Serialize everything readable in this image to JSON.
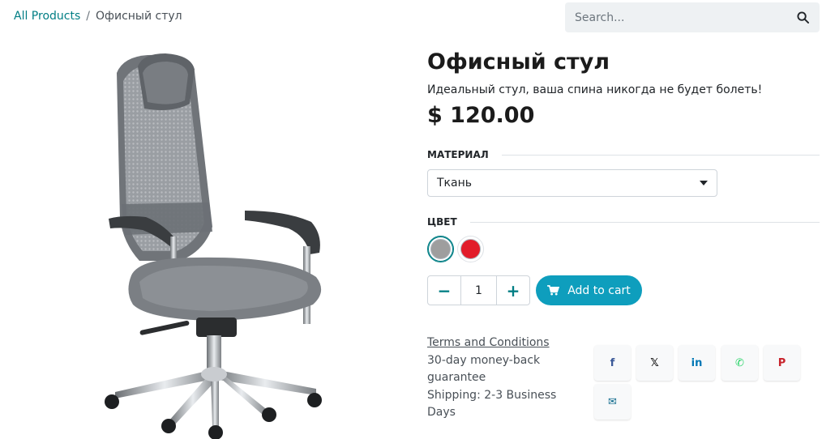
{
  "breadcrumb": {
    "root": "All Products",
    "separator": "/",
    "current": "Офисный стул"
  },
  "search": {
    "placeholder": "Search...",
    "icon": "search-icon"
  },
  "product": {
    "name": "Офисный стул",
    "description": "Идеальный стул, ваша спина никогда не будет болеть!",
    "price": "$ 120.00",
    "image": "office-chair-image"
  },
  "attributes": {
    "material": {
      "label": "МАТЕРИАЛ",
      "selected": "Ткань"
    },
    "color": {
      "label": "ЦВЕТ",
      "options": [
        {
          "name": "grey",
          "hex": "#9e9e9e",
          "selected": true
        },
        {
          "name": "red",
          "hex": "#e21c2a",
          "selected": false
        }
      ]
    }
  },
  "cart": {
    "quantity": "1",
    "minus": "−",
    "plus": "+",
    "add_label": "Add to cart"
  },
  "info": {
    "terms": "Terms and Conditions",
    "guarantee": "30-day money-back guarantee",
    "shipping": "Shipping: 2-3 Business Days"
  },
  "share": [
    {
      "name": "facebook-icon",
      "glyph": "f",
      "color": "#3b5998"
    },
    {
      "name": "x-icon",
      "glyph": "𝕏",
      "color": "#111111"
    },
    {
      "name": "linkedin-icon",
      "glyph": "in",
      "color": "#0077b5"
    },
    {
      "name": "whatsapp-icon",
      "glyph": "✆",
      "color": "#25d366"
    },
    {
      "name": "pinterest-icon",
      "glyph": "P",
      "color": "#c8232c"
    },
    {
      "name": "email-icon",
      "glyph": "✉",
      "color": "#0e6a8c"
    }
  ],
  "colors": {
    "accent": "#017e84",
    "button": "#0e9ebd"
  }
}
